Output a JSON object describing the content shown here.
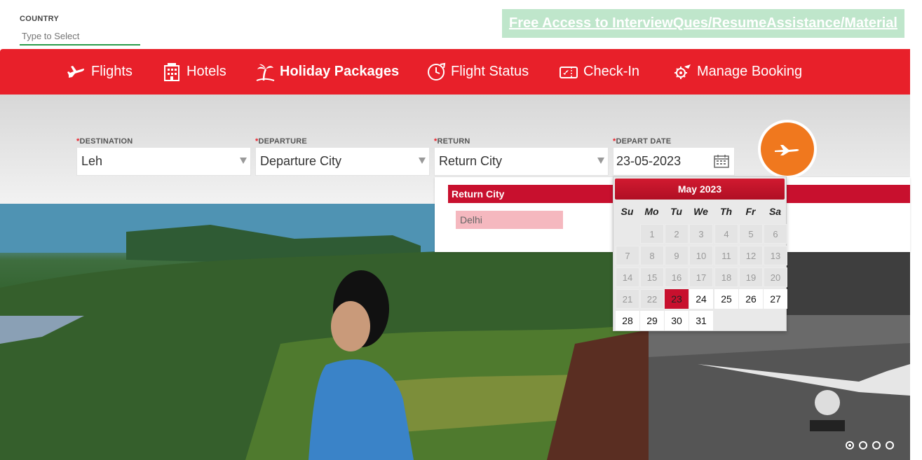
{
  "country": {
    "label": "COUNTRY",
    "placeholder": "Type to Select"
  },
  "promo": {
    "text": "Free Access to InterviewQues/ResumeAssistance/Material"
  },
  "nav": [
    {
      "label": "Flights",
      "icon": "plane-icon"
    },
    {
      "label": "Hotels",
      "icon": "hotel-icon"
    },
    {
      "label": "Holiday Packages",
      "icon": "palm-tree-icon",
      "active": true
    },
    {
      "label": "Flight Status",
      "icon": "clock-plane-icon"
    },
    {
      "label": "Check-In",
      "icon": "ticket-icon"
    },
    {
      "label": "Manage Booking",
      "icon": "gear-plane-icon"
    }
  ],
  "search": {
    "destination": {
      "label": "DESTINATION",
      "value": "Leh"
    },
    "departure": {
      "label": "DEPARTURE",
      "value": "Departure City"
    },
    "return": {
      "label": "RETURN",
      "value": "Return City"
    },
    "depart_date": {
      "label": "DEPART DATE",
      "value": "23-05-2023"
    },
    "required_mark": "*"
  },
  "return_dropdown": {
    "header": "Return City",
    "options": [
      "Delhi"
    ]
  },
  "calendar": {
    "title": "May 2023",
    "weekdays": [
      "Su",
      "Mo",
      "Tu",
      "We",
      "Th",
      "Fr",
      "Sa"
    ],
    "first_weekday_index": 1,
    "days_in_month": 31,
    "selected_day": 23,
    "first_enabled_day": 23
  },
  "carousel": {
    "slide_count": 4,
    "active_index": 0
  },
  "colors": {
    "nav_red": "#e8202a",
    "calendar_red": "#c8102e",
    "search_orange": "#f0781e",
    "promo_green": "#bfe6cb"
  }
}
